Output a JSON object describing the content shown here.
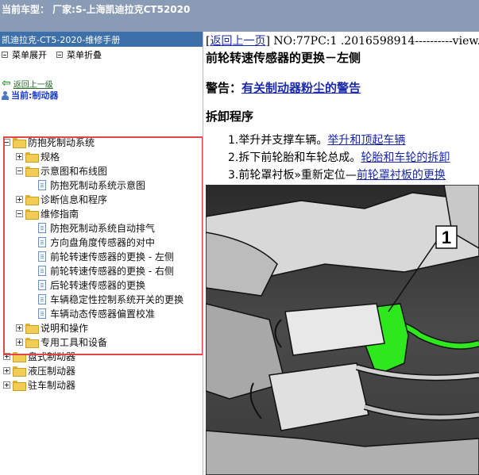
{
  "header": {
    "car_model_text": "当前车型：  厂家:S-上海凯迪拉克CT52020"
  },
  "left_panel": {
    "manual_title": "凯迪拉克-CT5-2020-维修手册",
    "toolbar": {
      "expand_label": "菜单展开",
      "collapse_label": "菜单折叠"
    },
    "back_link": "返回上一级",
    "current": "当前:制动器",
    "tree": [
      {
        "label": "防抱死制动系统",
        "type": "folder",
        "expander": "minus",
        "level": 0
      },
      {
        "label": "规格",
        "type": "folder",
        "expander": "plus",
        "level": 1
      },
      {
        "label": "示意图和布线图",
        "type": "folder",
        "expander": "minus",
        "level": 1
      },
      {
        "label": "防抱死制动系统示意图",
        "type": "doc",
        "expander": "none",
        "level": 2
      },
      {
        "label": "诊断信息和程序",
        "type": "folder",
        "expander": "plus",
        "level": 1
      },
      {
        "label": "维修指南",
        "type": "folder",
        "expander": "minus",
        "level": 1
      },
      {
        "label": "防抱死制动系统自动排气",
        "type": "doc",
        "expander": "none",
        "level": 2
      },
      {
        "label": "方向盘角度传感器的对中",
        "type": "doc",
        "expander": "none",
        "level": 2
      },
      {
        "label": "前轮转速传感器的更换 - 左侧",
        "type": "doc",
        "expander": "none",
        "level": 2
      },
      {
        "label": "前轮转速传感器的更换 - 右侧",
        "type": "doc",
        "expander": "none",
        "level": 2
      },
      {
        "label": "后轮转速传感器的更换",
        "type": "doc",
        "expander": "none",
        "level": 2
      },
      {
        "label": "车辆稳定性控制系统开关的更换",
        "type": "doc",
        "expander": "none",
        "level": 2
      },
      {
        "label": "车辆动态传感器偏置校准",
        "type": "doc",
        "expander": "none",
        "level": 2
      },
      {
        "label": "说明和操作",
        "type": "folder",
        "expander": "plus",
        "level": 1
      },
      {
        "label": "专用工具和设备",
        "type": "folder",
        "expander": "plus",
        "level": 1
      },
      {
        "label": "盘式制动器",
        "type": "folder",
        "expander": "plus",
        "level": 0
      },
      {
        "label": "液压制动器",
        "type": "folder",
        "expander": "plus",
        "level": 0
      },
      {
        "label": "驻车制动器",
        "type": "folder",
        "expander": "plus",
        "level": 0
      }
    ]
  },
  "content": {
    "nav": {
      "back_label": "返回上一页",
      "doc_info": " NO:77PC:1 .2016598914----------view."
    },
    "title": "前轮转速传感器的更换－左侧",
    "warning": {
      "prefix": "警告：",
      "link": "有关制动器粉尘的警告"
    },
    "section_title": "拆卸程序",
    "steps": [
      {
        "text": "1.举升并支撑车辆。",
        "link": "举升和顶起车辆"
      },
      {
        "text": "2.拆下前轮胎和车轮总成。",
        "link": "轮胎和车轮的拆卸"
      },
      {
        "text": "3.前轮罩衬板»重新定位—",
        "link": "前轮罩衬板的更换"
      }
    ],
    "diagram": {
      "callout": "1",
      "highlight_color": "#2ee81e"
    }
  }
}
